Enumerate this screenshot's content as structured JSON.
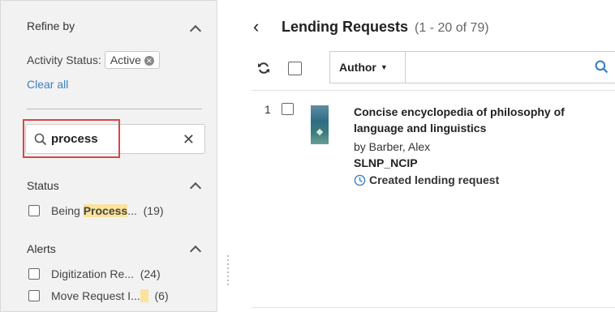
{
  "sidebar": {
    "refine_title": "Refine by",
    "activity_status_label": "Activity Status:",
    "activity_status_value": "Active",
    "clear_all": "Clear all",
    "search_value": "process",
    "facets": {
      "status": {
        "title": "Status",
        "items": [
          {
            "prefix": "Being ",
            "highlight": "Process",
            "suffix": "...",
            "count": "(19)"
          }
        ]
      },
      "alerts": {
        "title": "Alerts",
        "items": [
          {
            "label": "Digitization Re...",
            "count": "(24)"
          },
          {
            "label": "Move Request I...",
            "count": "(6)"
          }
        ]
      }
    }
  },
  "main": {
    "title": "Lending Requests",
    "count": "(1 - 20 of 79)",
    "search_field": "Author",
    "search_value": "",
    "record": {
      "index": "1",
      "title": "Concise encyclopedia of philosophy of language and linguistics",
      "author": "by Barber, Alex",
      "code": "SLNP_NCIP",
      "status": "Created lending request"
    }
  },
  "colors": {
    "accent": "#3d7fc1",
    "highlight": "#fbe39c",
    "callout": "#d8454a"
  },
  "icons": [
    "search-icon",
    "close-icon",
    "refresh-icon",
    "chevron-left-icon",
    "caret-up-icon",
    "clock-icon",
    "chip-remove-icon"
  ]
}
